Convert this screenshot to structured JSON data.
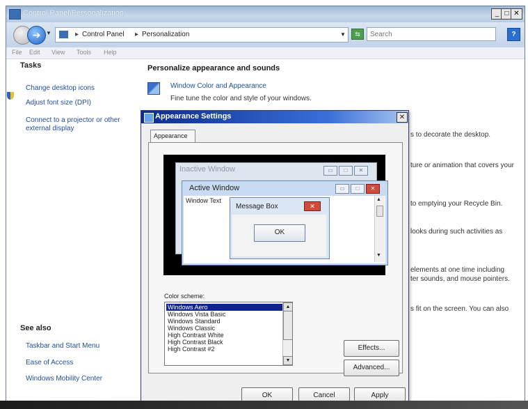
{
  "window": {
    "title": "Control Panel\\Personalization",
    "min_glyph": "_",
    "max_glyph": "□",
    "close_glyph": "✕"
  },
  "address_bar": {
    "crumb_separator": "▸",
    "crumbs": [
      "Control Panel",
      "Personalization"
    ],
    "search_placeholder": "Search",
    "help_glyph": "?"
  },
  "menu": [
    "File",
    "Edit",
    "View",
    "Tools",
    "Help"
  ],
  "tasks": {
    "heading": "Tasks",
    "links": [
      "Change desktop icons",
      "Adjust font size (DPI)",
      "Connect to a projector or other",
      "external display"
    ]
  },
  "see_also": {
    "heading": "See also",
    "links": [
      "Taskbar and Start Menu",
      "Ease of Access",
      "Windows Mobility Center"
    ]
  },
  "main": {
    "heading": "Personalize appearance and sounds",
    "wca_link": "Window Color and Appearance",
    "wca_desc": "Fine tune the color and style of your windows.",
    "partial_desc": [
      "s to decorate the desktop.",
      "ture or animation that covers your",
      "to emptying your Recycle Bin.",
      "looks during such activities as",
      "elements at one time including",
      "ter sounds, and mouse pointers.",
      "s fit on the screen. You can also"
    ]
  },
  "dialog": {
    "title": "Appearance Settings",
    "close_glyph": "✕",
    "tab": "Appearance",
    "preview": {
      "inactive_title": "Inactive Window",
      "active_title": "Active Window",
      "window_text": "Window Text",
      "message_box_title": "Message Box",
      "ok": "OK"
    },
    "color_scheme_label": "Color scheme:",
    "schemes": [
      "Windows Aero",
      "Windows Vista Basic",
      "Windows Standard",
      "Windows Classic",
      "High Contrast White",
      "High Contrast Black",
      "High Contrast #2"
    ],
    "selected_scheme": "Windows Aero",
    "effects": "Effects...",
    "advanced": "Advanced...",
    "ok": "OK",
    "cancel": "Cancel",
    "apply": "Apply"
  }
}
